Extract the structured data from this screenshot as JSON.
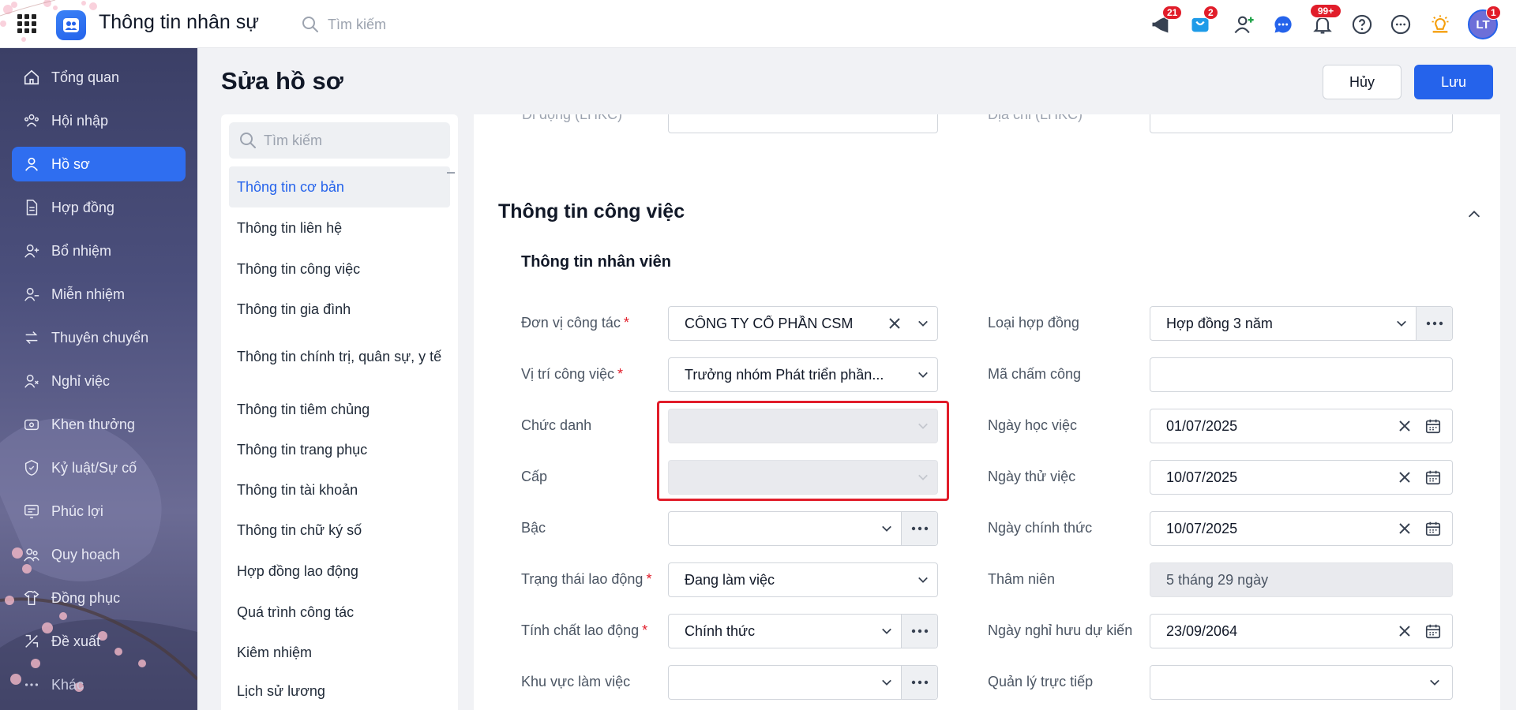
{
  "app": {
    "title": "Thông tin nhân sự",
    "search_placeholder": "Tìm kiếm"
  },
  "topbar": {
    "icons": [
      {
        "name": "megaphone-icon",
        "badge": "21"
      },
      {
        "name": "shopping-cart-icon",
        "badge": "2"
      },
      {
        "name": "add-user-icon",
        "badge": ""
      },
      {
        "name": "chat-icon",
        "badge": ""
      },
      {
        "name": "bell-icon",
        "badge": "99+"
      },
      {
        "name": "help-icon",
        "badge": ""
      },
      {
        "name": "more-icon",
        "badge": ""
      },
      {
        "name": "lightbulb-icon",
        "badge": ""
      }
    ],
    "avatar": {
      "initials": "LT",
      "badge": "1"
    }
  },
  "sidebar": {
    "items": [
      {
        "label": "Tổng quan",
        "icon": "home-icon"
      },
      {
        "label": "Hội nhập",
        "icon": "users-group-icon"
      },
      {
        "label": "Hồ sơ",
        "icon": "profile-icon",
        "active": true
      },
      {
        "label": "Hợp đồng",
        "icon": "document-icon"
      },
      {
        "label": "Bổ nhiệm",
        "icon": "user-plus-icon"
      },
      {
        "label": "Miễn nhiệm",
        "icon": "user-minus-icon"
      },
      {
        "label": "Thuyên chuyển",
        "icon": "transfer-icon"
      },
      {
        "label": "Nghỉ việc",
        "icon": "user-leave-icon"
      },
      {
        "label": "Khen thưởng",
        "icon": "reward-icon"
      },
      {
        "label": "Kỷ luật/Sự cố",
        "icon": "shield-alert-icon"
      },
      {
        "label": "Phúc lợi",
        "icon": "benefit-icon"
      },
      {
        "label": "Quy hoạch",
        "icon": "planning-icon"
      },
      {
        "label": "Đồng phục",
        "icon": "uniform-icon"
      },
      {
        "label": "Đề xuất",
        "icon": "proposal-icon"
      },
      {
        "label": "Khác",
        "icon": "ellipsis-icon"
      }
    ]
  },
  "page": {
    "title": "Sửa hồ sơ",
    "cancel_label": "Hủy",
    "save_label": "Lưu"
  },
  "sections_panel": {
    "search_placeholder": "Tìm kiếm",
    "items": [
      "Thông tin cơ bản",
      "Thông tin liên hệ",
      "Thông tin công việc",
      "Thông tin gia đình",
      "Thông tin chính trị, quân sự, y tế",
      "Thông tin tiêm chủng",
      "Thông tin trang phục",
      "Thông tin tài khoản",
      "Thông tin chữ ký số",
      "Hợp đồng lao động",
      "Quá trình công tác",
      "Kiêm nhiệm",
      "Lịch sử lương"
    ]
  },
  "content": {
    "ghost_left_label": "Di động (LHKC)",
    "ghost_right_label": "Địa chỉ (LHKC)",
    "section_title": "Thông tin công việc",
    "subsection_title": "Thông tin nhân viên",
    "left_fields": [
      {
        "label": "Đơn vị công tác",
        "required": true,
        "value": "CÔNG TY CỔ PHẦN CSM"
      },
      {
        "label": "Vị trí công việc",
        "required": true,
        "value": "Trưởng nhóm Phát triển phần..."
      },
      {
        "label": "Chức danh",
        "required": false,
        "value": ""
      },
      {
        "label": "Cấp",
        "required": false,
        "value": ""
      },
      {
        "label": "Bậc",
        "required": false,
        "value": ""
      },
      {
        "label": "Trạng thái lao động",
        "required": true,
        "value": "Đang làm việc"
      },
      {
        "label": "Tính chất lao động",
        "required": true,
        "value": "Chính thức"
      },
      {
        "label": "Khu vực làm việc",
        "required": false,
        "value": ""
      }
    ],
    "right_fields": [
      {
        "label": "Loại hợp đồng",
        "value": "Hợp đồng 3 năm"
      },
      {
        "label": "Mã chấm công",
        "value": ""
      },
      {
        "label": "Ngày học việc",
        "value": "01/07/2025"
      },
      {
        "label": "Ngày thử việc",
        "value": "10/07/2025"
      },
      {
        "label": "Ngày chính thức",
        "value": "10/07/2025"
      },
      {
        "label": "Thâm niên",
        "value": "5 tháng 29 ngày"
      },
      {
        "label": "Ngày nghỉ hưu dự kiến",
        "value": "23/09/2064"
      },
      {
        "label": "Quản lý trực tiếp",
        "value": ""
      }
    ]
  },
  "colors": {
    "accent": "#2563eb",
    "danger": "#e11d2a",
    "sidebar": "#4b4f7c"
  }
}
